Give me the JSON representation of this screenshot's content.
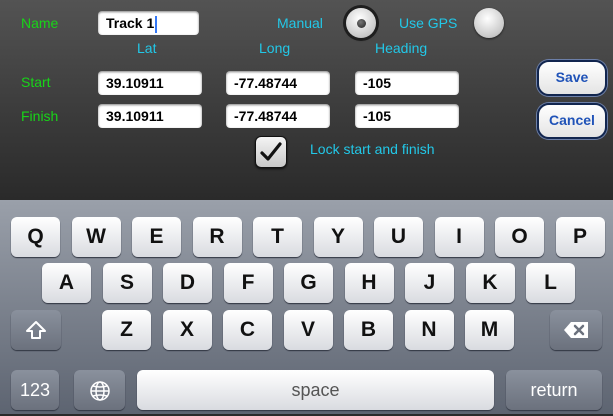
{
  "form": {
    "name_label": "Name",
    "name_value": "Track 1",
    "manual_label": "Manual",
    "gps_label": "Use GPS",
    "columns": {
      "lat": "Lat",
      "long": "Long",
      "heading": "Heading"
    },
    "start": {
      "label": "Start",
      "lat": "39.10911",
      "long": "-77.48744",
      "heading": "-105"
    },
    "finish": {
      "label": "Finish",
      "lat": "39.10911",
      "long": "-77.48744",
      "heading": "-105"
    },
    "lock_label": "Lock start and finish",
    "lock_checked": true,
    "selected_mode": "Manual",
    "save_label": "Save",
    "cancel_label": "Cancel"
  },
  "keyboard": {
    "row1": [
      "Q",
      "W",
      "E",
      "R",
      "T",
      "Y",
      "U",
      "I",
      "O",
      "P"
    ],
    "row2": [
      "A",
      "S",
      "D",
      "F",
      "G",
      "H",
      "J",
      "K",
      "L"
    ],
    "row3": [
      "Z",
      "X",
      "C",
      "V",
      "B",
      "N",
      "M"
    ],
    "numbers_label": "123",
    "space_label": "space",
    "return_label": "return",
    "icons": {
      "shift": "shift-icon",
      "backspace": "backspace-icon",
      "globe": "globe-icon"
    }
  },
  "colors": {
    "label_green": "#18d418",
    "label_cyan": "#22c8e8",
    "button_text": "#2053b8"
  }
}
